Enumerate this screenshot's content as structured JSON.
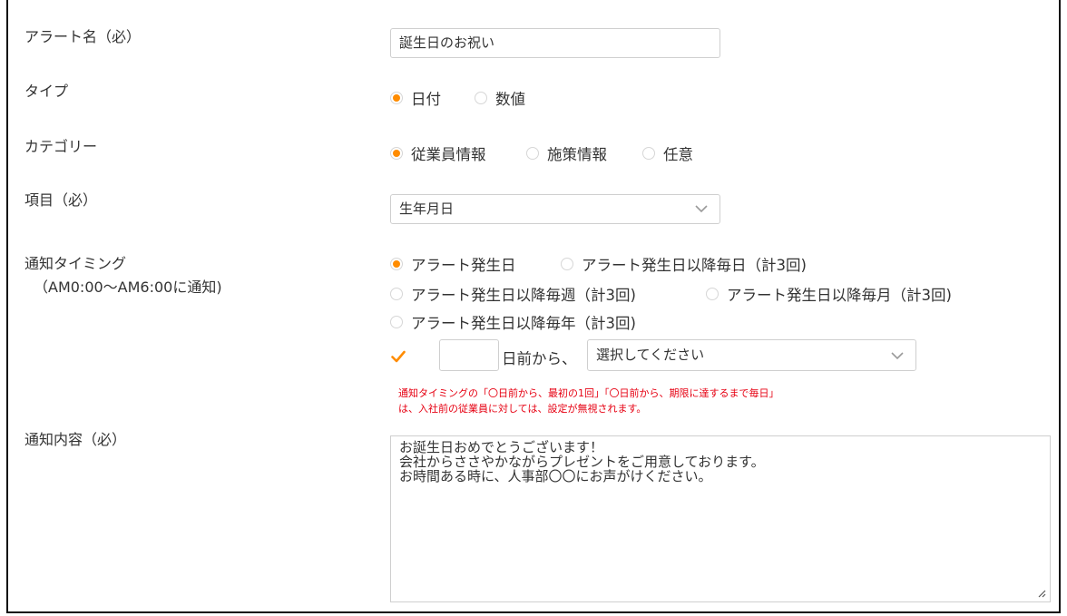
{
  "colors": {
    "accent": "#ff8c00",
    "note": "#e60012",
    "border": "#cfcfcf"
  },
  "fields": {
    "alert_name": {
      "label": "アラート名（必）",
      "value": "誕生日のお祝い"
    },
    "type": {
      "label": "タイプ",
      "options": [
        "日付",
        "数値"
      ],
      "selected": "日付"
    },
    "category": {
      "label": "カテゴリー",
      "options": [
        "従業員情報",
        "施策情報",
        "任意"
      ],
      "selected": "従業員情報"
    },
    "item": {
      "label": "項目（必）",
      "value": "生年月日"
    },
    "timing": {
      "label": "通知タイミング",
      "sublabel": "（AM0:00～AM6:00に通知)",
      "options": [
        "アラート発生日",
        "アラート発生日以降毎日（計3回)",
        "アラート発生日以降毎週（計3回)",
        "アラート発生日以降毎月（計3回)",
        "アラート発生日以降毎年（計3回)"
      ],
      "selected": "アラート発生日",
      "days_before": {
        "checked": true,
        "value": "",
        "suffix": "日前から、",
        "select_value": "選択してください"
      },
      "notes": [
        "通知タイミングの「〇日前から、最初の1回」「〇日前から、期限に達するまで毎日」",
        "は、入社前の従業員に対しては、設定が無視されます。"
      ]
    },
    "content": {
      "label": "通知内容（必）",
      "lines": [
        "お誕生日おめでとうございます！",
        "会社からささやかながらプレゼントをご用意しております。",
        "お時間ある時に、人事部〇〇にお声がけください。"
      ]
    }
  },
  "icons": {
    "dropdown": "chevron-down-icon",
    "check": "checkmark-icon",
    "resize": "resize-grip-icon"
  }
}
